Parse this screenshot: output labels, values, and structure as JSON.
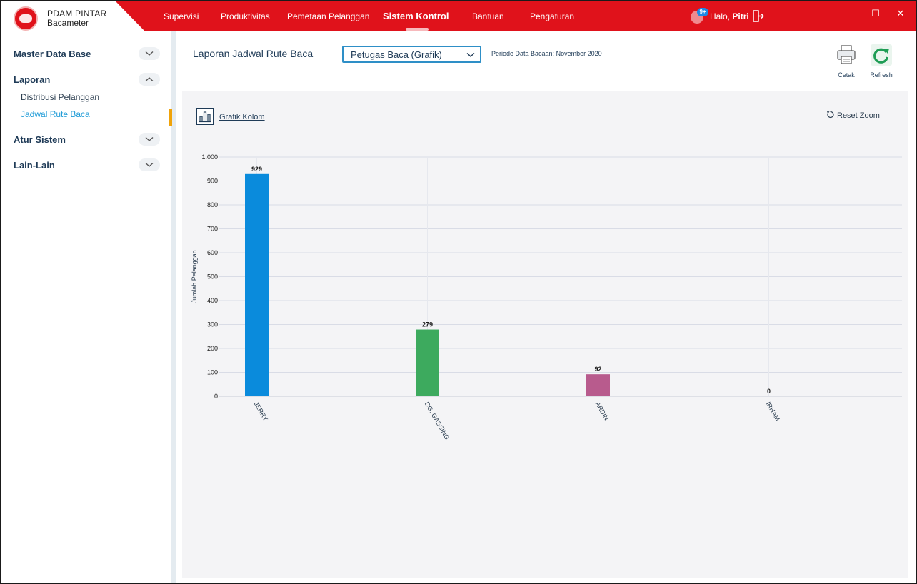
{
  "app": {
    "name": "PDAM PINTAR",
    "product": "Bacameter"
  },
  "nav": {
    "items": [
      "Supervisi",
      "Produktivitas",
      "Pemetaan Pelanggan",
      "Sistem Kontrol",
      "Bantuan",
      "Pengaturan"
    ],
    "active": "Sistem Kontrol"
  },
  "user": {
    "greeting": "Halo,",
    "name": "Pitri",
    "notification_badge": "9+"
  },
  "window_controls": {
    "minimize": "—",
    "maximize": "☐",
    "close": "✕"
  },
  "sidebar": {
    "sections": [
      {
        "label": "Master Data Base",
        "expanded": false
      },
      {
        "label": "Laporan",
        "expanded": true,
        "items": [
          "Distribusi Pelanggan",
          "Jadwal Rute Baca"
        ],
        "active_item": "Jadwal Rute Baca"
      },
      {
        "label": "Atur Sistem",
        "expanded": false
      },
      {
        "label": "Lain-Lain",
        "expanded": false
      }
    ]
  },
  "header": {
    "title": "Laporan Jadwal Rute Baca",
    "view_select": "Petugas Baca (Grafik)",
    "periode_label": "Periode Data Bacaan:",
    "periode_value": "November 2020",
    "print_label": "Cetak",
    "refresh_label": "Refresh"
  },
  "chart_panel": {
    "chart_type_label": "Grafik Kolom",
    "reset_zoom_label": "Reset Zoom"
  },
  "colors": {
    "accent": "#e0121b",
    "link": "#1e9bd7",
    "active_marker": "#f0a30a"
  },
  "chart_data": {
    "type": "bar",
    "categories": [
      "JERRY",
      "DG. GASSING",
      "ARDIN",
      "IRHAM"
    ],
    "values": [
      929,
      279,
      92,
      0
    ],
    "colors": [
      "#0a8bdc",
      "#3daa5e",
      "#b85b8d",
      "#7a7a7a"
    ],
    "ylabel": "Jumlah Pelanggan",
    "xlabel": "",
    "ylim": [
      0,
      1000
    ],
    "yticks": [
      "0",
      "100",
      "200",
      "300",
      "400",
      "500",
      "600",
      "700",
      "800",
      "900",
      "1.000"
    ],
    "grid": true,
    "data_labels": [
      "929",
      "279",
      "92",
      "0"
    ]
  }
}
